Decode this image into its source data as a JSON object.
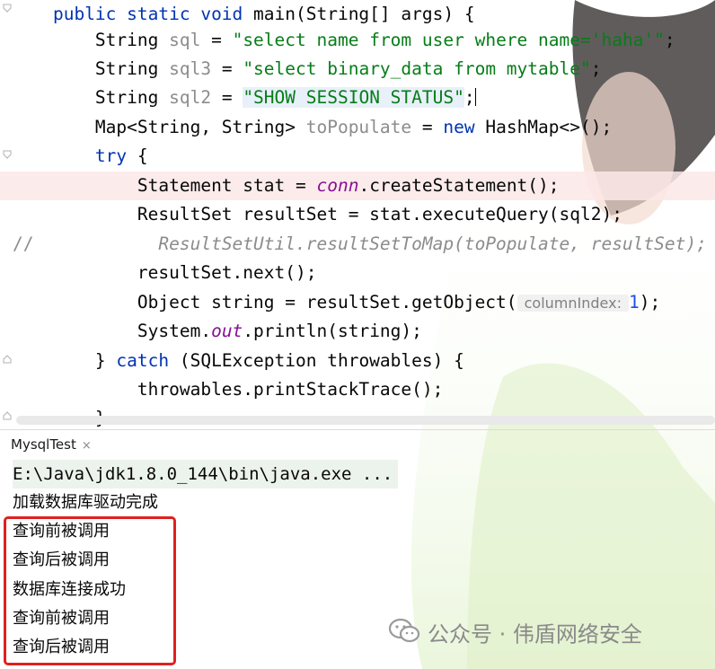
{
  "editor": {
    "lines": [
      {
        "indent": "    ",
        "tokens": [
          {
            "t": "public static void ",
            "c": "kw"
          },
          {
            "t": "main(String[] args) {",
            "c": ""
          }
        ]
      },
      {
        "indent": "        ",
        "tokens": [
          {
            "t": "String ",
            "c": ""
          },
          {
            "t": "sql",
            "c": "gray"
          },
          {
            "t": " = ",
            "c": ""
          },
          {
            "t": "\"select name from user where name='haha'\"",
            "c": "str"
          },
          {
            "t": ";",
            "c": ""
          }
        ]
      },
      {
        "indent": "        ",
        "tokens": [
          {
            "t": "String ",
            "c": ""
          },
          {
            "t": "sql3",
            "c": "gray"
          },
          {
            "t": " = ",
            "c": ""
          },
          {
            "t": "\"select binary_data from mytable\"",
            "c": "str"
          },
          {
            "t": ";",
            "c": ""
          }
        ]
      },
      {
        "indent": "        ",
        "tokens": [
          {
            "t": "String ",
            "c": ""
          },
          {
            "t": "sql2",
            "c": "gray"
          },
          {
            "t": " = ",
            "c": ""
          },
          {
            "t": "\"SHOW SESSION STATUS\"",
            "c": "str"
          },
          {
            "t": ";",
            "c": ""
          }
        ]
      },
      {
        "indent": "        ",
        "tokens": [
          {
            "t": "Map<String, String> ",
            "c": ""
          },
          {
            "t": "toPopulate",
            "c": "gray"
          },
          {
            "t": " = ",
            "c": ""
          },
          {
            "t": "new ",
            "c": "kw"
          },
          {
            "t": "HashMap<>();",
            "c": ""
          }
        ]
      },
      {
        "indent": "        ",
        "tokens": [
          {
            "t": "try ",
            "c": "kw"
          },
          {
            "t": "{",
            "c": ""
          }
        ]
      },
      {
        "indent": "            ",
        "tokens": [
          {
            "t": "Statement stat = ",
            "c": ""
          },
          {
            "t": "conn",
            "c": "purple ital"
          },
          {
            "t": ".createStatement();",
            "c": ""
          }
        ]
      },
      {
        "indent": "            ",
        "tokens": [
          {
            "t": "ResultSet resultSet = stat.executeQuery(sql2);",
            "c": ""
          }
        ]
      },
      {
        "indent": "              ",
        "tokens": [
          {
            "t": "ResultSetUtil.resultSetToMap(toPopulate, resultSet);",
            "c": "gray ital"
          }
        ]
      },
      {
        "indent": "            ",
        "tokens": [
          {
            "t": "resultSet.next();",
            "c": ""
          }
        ]
      },
      {
        "indent": "            ",
        "tokens": [
          {
            "t": "Object string = resultSet.getObject(",
            "c": ""
          },
          {
            "t": " columnIndex: ",
            "c": "hint"
          },
          {
            "t": "1",
            "c": "num"
          },
          {
            "t": ");",
            "c": ""
          }
        ]
      },
      {
        "indent": "            ",
        "tokens": [
          {
            "t": "System.",
            "c": ""
          },
          {
            "t": "out",
            "c": "purple ital"
          },
          {
            "t": ".println(string);",
            "c": ""
          }
        ]
      },
      {
        "indent": "        ",
        "tokens": [
          {
            "t": "} ",
            "c": ""
          },
          {
            "t": "catch ",
            "c": "kw"
          },
          {
            "t": "(SQLException throwables) {",
            "c": ""
          }
        ]
      },
      {
        "indent": "            ",
        "tokens": [
          {
            "t": "throwables.printStackTrace();",
            "c": ""
          }
        ]
      },
      {
        "indent": "        ",
        "tokens": [
          {
            "t": "}",
            "c": ""
          }
        ]
      }
    ],
    "comment_marker": "//"
  },
  "run_tab": {
    "label": "MysqlTest",
    "close_glyph": "×"
  },
  "console": {
    "lines": [
      "E:\\Java\\jdk1.8.0_144\\bin\\java.exe ...",
      "加载数据库驱动完成",
      "查询前被调用",
      "查询后被调用",
      "数据库连接成功",
      "查询前被调用",
      "查询后被调用"
    ]
  },
  "watermark": {
    "text": "公众号 · 伟盾网络安全",
    "icon": "wechat-icon"
  },
  "colors": {
    "keyword": "#0033b3",
    "string": "#067d17",
    "red_box": "#e02020",
    "highlight_row": "#fce8e8"
  }
}
